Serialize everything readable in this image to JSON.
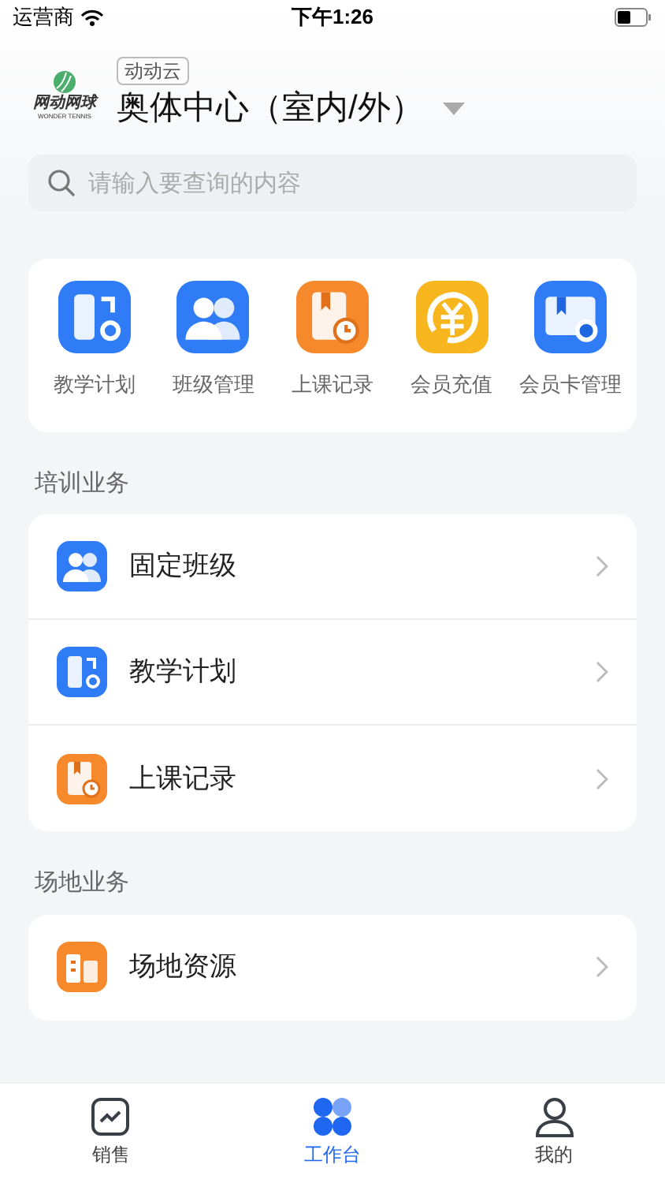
{
  "status_bar": {
    "carrier": "运营商",
    "time": "下午1:26"
  },
  "header": {
    "logo_text": "网动网球",
    "logo_subtext": "WONDER TENNIS",
    "tag": "动动云",
    "venue": "奥体中心（室内/外）"
  },
  "search": {
    "placeholder": "请输入要查询的内容"
  },
  "shortcuts": [
    {
      "label": "教学计划",
      "kind": "plan",
      "color": "#2f7cf6"
    },
    {
      "label": "班级管理",
      "kind": "class",
      "color": "#2f7cf6"
    },
    {
      "label": "上课记录",
      "kind": "record",
      "color": "#f5892b"
    },
    {
      "label": "会员充值",
      "kind": "recharge",
      "color": "#f7b51e"
    },
    {
      "label": "会员卡管理",
      "kind": "card",
      "color": "#2f7cf6"
    }
  ],
  "sections": [
    {
      "title": "培训业务",
      "items": [
        {
          "label": "固定班级",
          "kind": "class",
          "color": "#2f7cf6"
        },
        {
          "label": "教学计划",
          "kind": "plan",
          "color": "#2f7cf6"
        },
        {
          "label": "上课记录",
          "kind": "record",
          "color": "#f5892b"
        }
      ]
    },
    {
      "title": "场地业务",
      "items": [
        {
          "label": "场地资源",
          "kind": "venue",
          "color": "#f5892b"
        }
      ]
    }
  ],
  "tab_bar": [
    {
      "label": "销售",
      "kind": "sales",
      "selected": false
    },
    {
      "label": "工作台",
      "kind": "workbench",
      "selected": true
    },
    {
      "label": "我的",
      "kind": "profile",
      "selected": false
    }
  ]
}
